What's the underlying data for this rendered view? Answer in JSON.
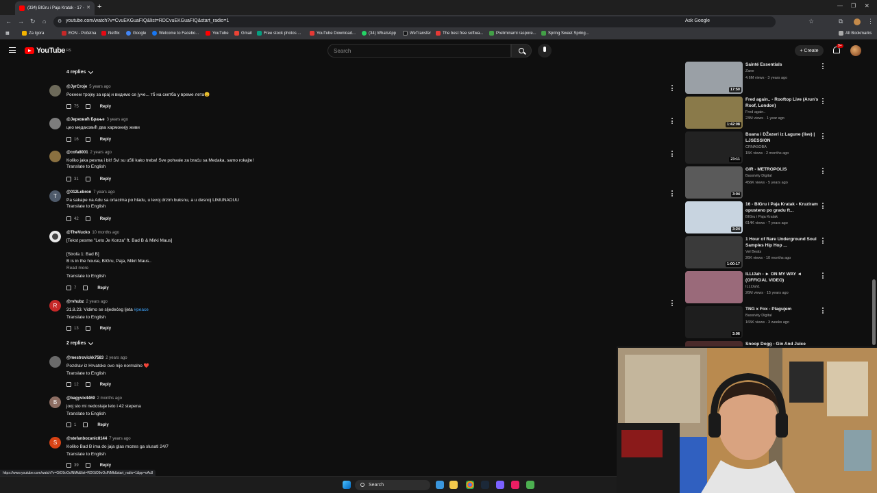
{
  "browser": {
    "tab_title": "(334) BIGru i Paja Kratak - 17 -",
    "url": "youtube.com/watch?v=CvuEKGuaFIQ&list=RDCvuEKGuaFIQ&start_radio=1",
    "ask_google": "Ask Google",
    "bookmarks": [
      "Za Igora",
      "EON - Početna",
      "Netflix",
      "Google",
      "Welcome to Facebo...",
      "YouTube",
      "Gmail",
      "Free stock photos ...",
      "YouTube Download...",
      "(34) WhatsApp",
      "WeTransfer",
      "The best free softwa...",
      "Preliminarni raspore...",
      "Spring Sweet Spring..."
    ],
    "all_bookmarks": "All Bookmarks"
  },
  "youtube": {
    "logo_text": "YouTube",
    "logo_sup": "RS",
    "search_placeholder": "Search",
    "create_label": "Create",
    "notif_badge": "9+"
  },
  "comments": {
    "top_replies_toggle": "4 replies",
    "items": [
      {
        "author": "@JyrCroje",
        "time": "5 years ago",
        "text": "Рокнем тројку за крај и видимо се јуче... тб на скетба у време лета😊",
        "likes": "75",
        "translate": "",
        "reply": "Reply"
      },
      {
        "author": "@Јерковић Брање",
        "time": "3 years ago",
        "text": "цео медаковић два хармонију живи",
        "likes": "16",
        "translate": "",
        "reply": "Reply"
      },
      {
        "author": "@cofa8001",
        "time": "2 years ago",
        "text": "Koliko jaka pesma i bit! Svi su uSli kako treba! Sve pohvale za braću sa Medaka, samo rokajte!",
        "likes": "31",
        "translate": "Translate to English",
        "reply": "Reply"
      },
      {
        "author": "@012Lebron",
        "time": "7 years ago",
        "text": "Pa sakape na Adu sa ortacima po hladu, u levoj drzim buksnu, a u desnoj LIMUNADUU",
        "likes": "42",
        "translate": "Translate to English",
        "reply": "Reply"
      },
      {
        "author": "@TheVucko",
        "time": "10 months ago",
        "text": "[Tekst pesme \"Leto Je Konza\" ft. Bad B & Mirki Maus]",
        "text2": "[Strofa 1: Bad B]",
        "text3": "B is in the house, BIGru, Paja, Mikri Maus..",
        "read_more": "Read more",
        "likes": "7",
        "translate": "Translate to English",
        "reply": "Reply"
      },
      {
        "author": "@rvhubz",
        "time": "2 years ago",
        "text": "31.8.23. Vidimo se sljedećeg ljeta",
        "tag": "#peace",
        "likes": "13",
        "translate": "Translate to English",
        "reply": "Reply"
      }
    ],
    "mid_replies_toggle": "2 replies",
    "items2": [
      {
        "author": "@mestrovickk7583",
        "time": "2 years ago",
        "text": "Pozdrav iz Hrvatske ovo nije normalno ❤️",
        "likes": "12",
        "translate": "Translate to English",
        "reply": "Reply"
      },
      {
        "author": "@bagyvix4469",
        "time": "2 months ago",
        "text": "jooj sto mi nedostaje leto i 42 stepena",
        "likes": "1",
        "translate": "Translate to English",
        "reply": "Reply"
      },
      {
        "author": "@stefanbozanic8144",
        "time": "7 years ago",
        "text": "Koliko Bad B ima do jaja glas mozes ga slusati 24/7",
        "likes": "39",
        "translate": "Translate to English",
        "reply": "Reply"
      }
    ]
  },
  "related": [
    {
      "title": "Sainté Essentials",
      "channel": "Zane",
      "stats": "4.6M views · 3 years ago",
      "duration": "17:50",
      "color": "#9aa0a6"
    },
    {
      "title": "Fred again.. - Rooftop Live (Arun's Roof, London)",
      "channel": "Fred again..",
      "stats": "23M views · 1 year ago",
      "duration": "1:42:08",
      "color": "#8a7a4a"
    },
    {
      "title": "Buana i DŽezeri iz Lagune (live) | LJSESSION",
      "channel": "CRNASOBA",
      "stats": "15K views · 2 months ago",
      "duration": "23:11",
      "color": "#222222"
    },
    {
      "title": "GIR - METROPOLIS",
      "channel": "Bassivity Digital",
      "stats": "456K views · 5 years ago",
      "duration": "3:04",
      "color": "#5a5a5a"
    },
    {
      "title": "16 - BIGru i Paja Kratak - Kruziram opusteno po gradu ft...",
      "channel": "BIGru i Paja Kratak",
      "stats": "614K views · 7 years ago",
      "duration": "3:24",
      "color": "#c8d4e0"
    },
    {
      "title": "1 Hour of Rare Underground Soul Samples Hip Hop ...",
      "channel": "Vel Beats",
      "stats": "26K views · 10 months ago",
      "duration": "1:00:17",
      "color": "#3a3a3a"
    },
    {
      "title": "ILLIJah - ► ON MY WAY ◄ (OFFICIAL VIDEO)",
      "channel": "ILLIJah1",
      "stats": "26M views · 15 years ago",
      "duration": "",
      "color": "#9a6a7a"
    },
    {
      "title": "TNG x Fox - Plagujem",
      "channel": "Bassivity Digital",
      "stats": "165K views · 3 weeks ago",
      "duration": "3:06",
      "color": "#1e1e1e"
    },
    {
      "title": "Snoop Dogg - Gin And Juice",
      "channel": "",
      "stats": "",
      "duration": "",
      "color": "#4a2a2a"
    }
  ],
  "status_url": "https://www.youtube.com/watch?v=GtO9oOcfNMk&list=RDGtO9oOcfNMk&start_radio=1&pp=oAc8",
  "taskbar": {
    "search_label": "Search"
  },
  "colors": {
    "accent_red": "#ff0000",
    "link_blue": "#3ea6ff",
    "bg": "#0f0f0f"
  }
}
